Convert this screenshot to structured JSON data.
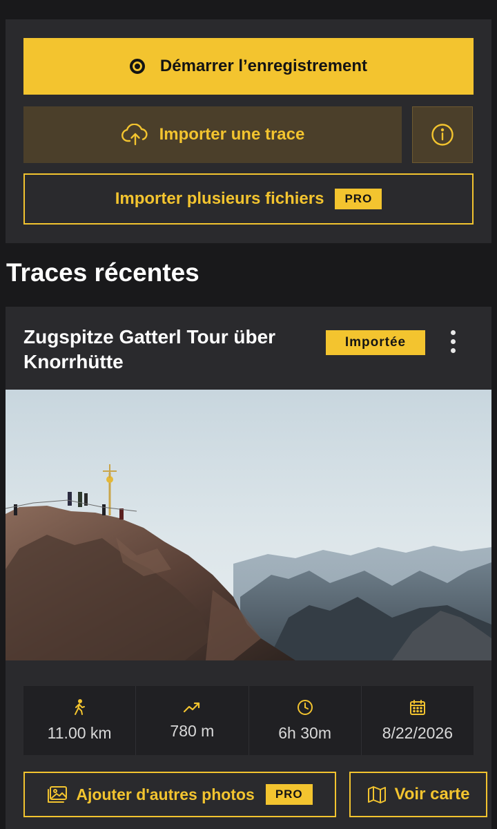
{
  "actions": {
    "record_label": "Démarrer l’enregistrement",
    "import_label": "Importer une trace",
    "import_multiple_label": "Importer plusieurs fichiers",
    "pro_badge": "PRO"
  },
  "recent": {
    "section_title": "Traces récentes",
    "track": {
      "title": "Zugspitze Gatterl Tour über Knorrhütte",
      "status": "Importée",
      "stats": [
        {
          "icon": "hiker-icon",
          "value": "11.00 km"
        },
        {
          "icon": "trending-up-icon",
          "value": "780 m"
        },
        {
          "icon": "clock-icon",
          "value": "6h 30m"
        },
        {
          "icon": "calendar-icon",
          "value": "8/22/2026"
        }
      ],
      "add_photos_label": "Ajouter d'autres photos",
      "add_photos_badge": "PRO",
      "view_map_label": "Voir carte"
    }
  },
  "colors": {
    "accent": "#f3c42f",
    "background": "#19191b",
    "panel": "#2a2a2d",
    "import_button_bg": "#4b3f2a"
  }
}
